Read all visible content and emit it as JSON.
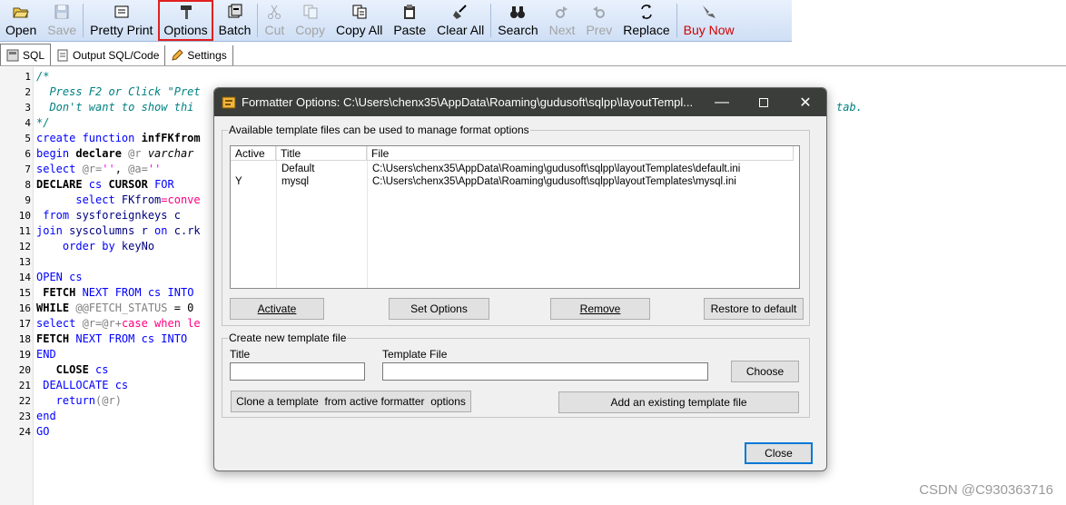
{
  "toolbar": {
    "open": "Open",
    "save": "Save",
    "pretty_print": "Pretty Print",
    "options": "Options",
    "batch": "Batch",
    "cut": "Cut",
    "copy": "Copy",
    "copy_all": "Copy All",
    "paste": "Paste",
    "clear_all": "Clear All",
    "search": "Search",
    "next": "Next",
    "prev": "Prev",
    "replace": "Replace",
    "buy_now": "Buy Now"
  },
  "tabs": [
    {
      "label": "SQL"
    },
    {
      "label": "Output SQL/Code"
    },
    {
      "label": "Settings"
    }
  ],
  "editor": {
    "line_numbers": [
      "1",
      "2",
      "3",
      "4",
      "5",
      "6",
      "7",
      "8",
      "9",
      "10",
      "11",
      "12",
      "13",
      "14",
      "15",
      "16",
      "17",
      "18",
      "19",
      "20",
      "21",
      "22",
      "23",
      "24"
    ],
    "line1": "/*",
    "line2": "  Press F2 or Click \"Pret",
    "line3": "  Don't want to show thi",
    "line3_tail": "tab.",
    "line4": "*/",
    "l5_kw": "create function",
    "l5_name": " infFKfrom",
    "l6_kw": "begin",
    "l6_kw2": " declare",
    "l6_var": " @r",
    "l6_type": " varchar",
    "l7_kw": "select",
    "l7_var1": " @r=",
    "l7_str1": "''",
    "l7_punct": ", ",
    "l7_var2": "@a=",
    "l7_str2": "''",
    "l8_kw": "DECLARE",
    "l8_name": " cs",
    "l8_kw2": " CURSOR",
    "l8_kw3": " FOR",
    "l9_kw": "      select",
    "l9_rest": " FKfrom",
    "l9_fn": "=conve",
    "l10_kw": " from",
    "l10_rest": " sysforeignkeys c",
    "l11_kw": "join",
    "l11_rest": " syscolumns r",
    "l11_kw2": " on",
    "l11_rest2": " c.rk",
    "l12_kw": "    order by",
    "l12_rest": " keyNo",
    "l14_kw": "OPEN",
    "l14_rest": " cs",
    "l15_kw": " FETCH",
    "l15_kw2": " NEXT",
    "l15_kw3": " FROM",
    "l15_rest": " cs",
    "l15_kw4": " INTO",
    "l16_kw": "WHILE",
    "l16_var": " @@FETCH_STATUS",
    "l16_rest": " = 0",
    "l17_kw": "select",
    "l17_var": " @r=@r+",
    "l17_kw2": "case when",
    "l17_rest": " le",
    "l18_kw": "FETCH",
    "l18_kw2": " NEXT",
    "l18_kw3": " FROM",
    "l18_rest": " cs",
    "l18_kw4": " INTO",
    "l19_kw": "END",
    "l20_kw": "   CLOSE",
    "l20_rest": " cs",
    "l21_kw": " DEALLOCATE",
    "l21_rest": " cs",
    "l22_kw": "   return",
    "l22_var": "(@r)",
    "l23_kw": "end",
    "l24_kw": "GO"
  },
  "dialog": {
    "title": "Formatter Options: C:\\Users\\chenx35\\AppData\\Roaming\\gudusoft\\sqlpp\\layoutTempl...",
    "available_group_label": "Available template files can be used to manage format options",
    "columns": [
      "Active",
      "Title",
      "File"
    ],
    "rows": [
      {
        "active": "",
        "title": "Default",
        "file": "C:\\Users\\chenx35\\AppData\\Roaming\\gudusoft\\sqlpp\\layoutTemplates\\default.ini"
      },
      {
        "active": "Y",
        "title": "mysql",
        "file": "C:\\Users\\chenx35\\AppData\\Roaming\\gudusoft\\sqlpp\\layoutTemplates\\mysql.ini"
      }
    ],
    "activate": "Activate",
    "set_options": "Set Options",
    "remove": "Remove",
    "restore_default": "Restore to default",
    "create_group_label": "Create new template file",
    "title_label": "Title",
    "template_file_label": "Template File",
    "title_value": "",
    "template_file_value": "",
    "choose": "Choose",
    "clone": "Clone a template  from active formatter  options",
    "add_existing": "Add an existing template file",
    "close": "Close"
  },
  "watermark": "CSDN @C930363716",
  "colors": {
    "toolbar_top": "#e9f1fd",
    "toolbar_bottom": "#cfdff5",
    "dialog_titlebar": "#3a3d3a",
    "highlight": "#e02020",
    "buy_now": "#d10000"
  }
}
